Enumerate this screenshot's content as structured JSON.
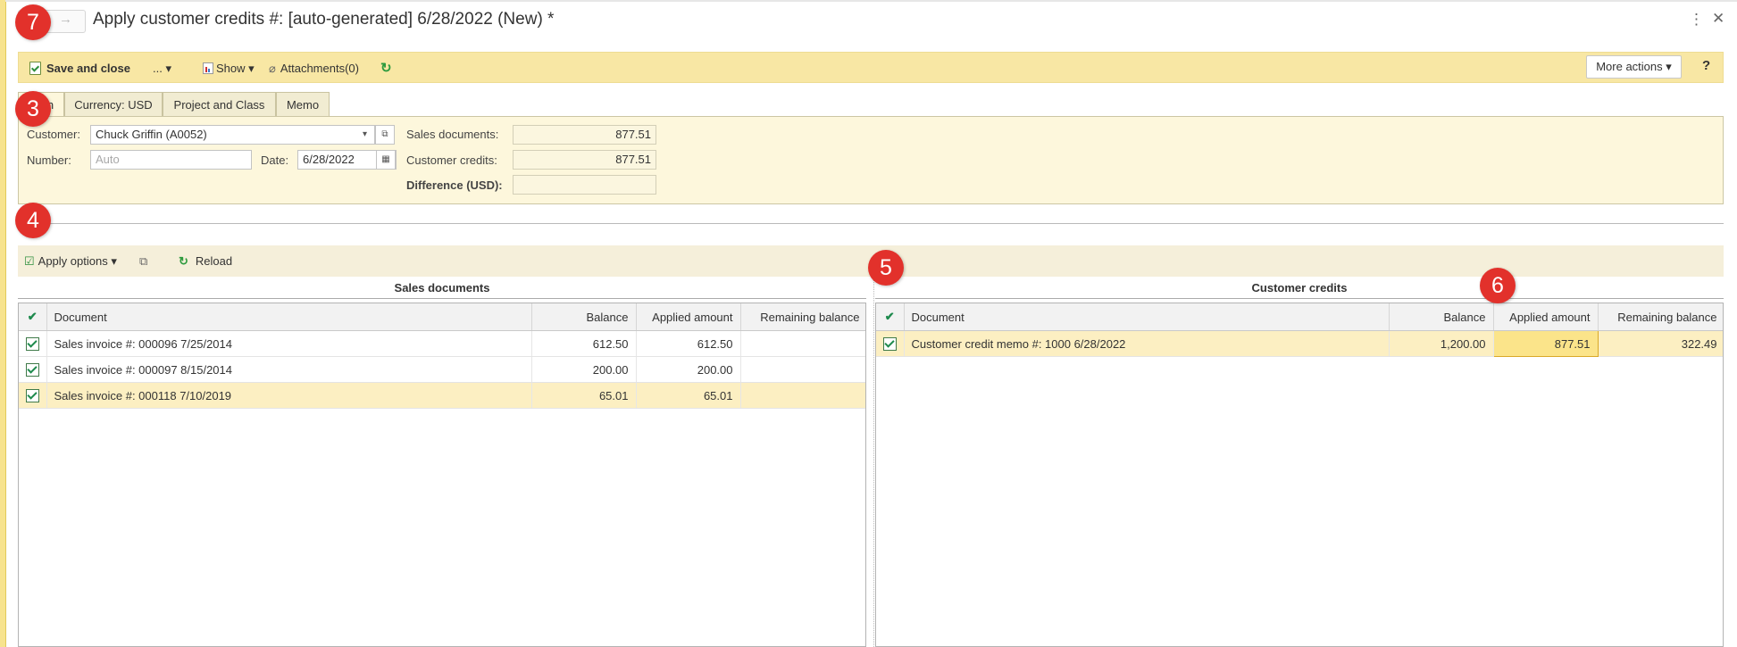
{
  "window": {
    "title": "Apply customer credits #: [auto-generated] 6/28/2022 (New) *",
    "nav_forward": "→",
    "menu_icon": "⋮",
    "close_icon": "✕"
  },
  "toolbar": {
    "save_close": "Save and close",
    "ellipsis": "... ▾",
    "show": "Show ▾",
    "attachments": "Attachments(0)",
    "refresh_icon": "↻",
    "more_actions": "More actions ▾",
    "help": "?"
  },
  "tabs": [
    {
      "label": "Main"
    },
    {
      "label": "Currency: USD"
    },
    {
      "label": "Project and Class"
    },
    {
      "label": "Memo"
    }
  ],
  "form": {
    "customer_label": "Customer:",
    "customer_value": "Chuck Griffin (A0052)",
    "number_label": "Number:",
    "number_placeholder": "Auto",
    "date_label": "Date:",
    "date_value": "6/28/2022",
    "sales_docs_label": "Sales documents:",
    "sales_docs_value": "877.51",
    "customer_credits_label": "Customer credits:",
    "customer_credits_value": "877.51",
    "difference_label": "Difference (USD):",
    "difference_value": ""
  },
  "subtoolbar": {
    "apply_options": "Apply options ▾",
    "reload": "Reload"
  },
  "sales_documents": {
    "title": "Sales documents",
    "columns": [
      "Document",
      "Balance",
      "Applied amount",
      "Remaining balance"
    ],
    "rows": [
      {
        "document": "Sales invoice #: 000096 7/25/2014",
        "balance": "612.50",
        "applied": "612.50",
        "remaining": ""
      },
      {
        "document": "Sales invoice #: 000097 8/15/2014",
        "balance": "200.00",
        "applied": "200.00",
        "remaining": ""
      },
      {
        "document": "Sales invoice #: 000118 7/10/2019",
        "balance": "65.01",
        "applied": "65.01",
        "remaining": ""
      }
    ]
  },
  "customer_credits": {
    "title": "Customer credits",
    "columns": [
      "Document",
      "Balance",
      "Applied amount",
      "Remaining balance"
    ],
    "rows": [
      {
        "document": "Customer credit memo #: 1000 6/28/2022",
        "balance": "1,200.00",
        "applied": "877.51",
        "remaining": "322.49"
      }
    ]
  },
  "callouts": [
    "7",
    "3",
    "4",
    "5",
    "6"
  ],
  "colors": {
    "accent_yellow": "#f8e7a4",
    "panel_yellow": "#fdf7dc",
    "badge_red": "#e2312b",
    "check_green": "#1e8a4d"
  }
}
